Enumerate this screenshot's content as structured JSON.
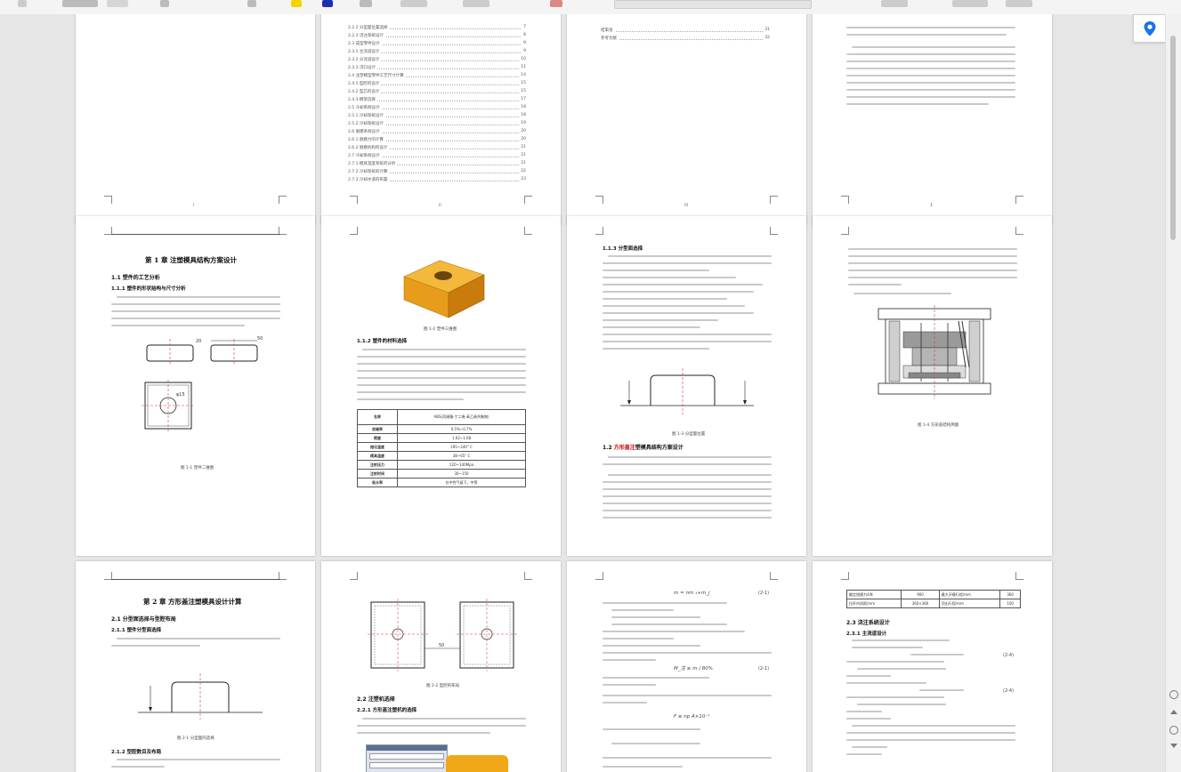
{
  "pages": {
    "p1": {
      "page_number": "i"
    },
    "p2": {
      "page_number": "ii",
      "toc": [
        {
          "label": "2.2.2 分型面位置选择",
          "page": "7"
        },
        {
          "label": "2.2.3 浇注系统设计",
          "page": "8"
        },
        {
          "label": "2.3 成型零件设计",
          "page": "9"
        },
        {
          "label": "2.3.1 主流道设计",
          "page": "9"
        },
        {
          "label": "2.3.2 分流道设计",
          "page": "10"
        },
        {
          "label": "2.3.3 浇口设计",
          "page": "11"
        },
        {
          "label": "2.4 注塑模型零件工艺尺寸计算",
          "page": "14"
        },
        {
          "label": "2.4.1 型腔的设计",
          "page": "15"
        },
        {
          "label": "2.4.2 型芯的设计",
          "page": "15"
        },
        {
          "label": "2.4.3 模架选择",
          "page": "17"
        },
        {
          "label": "2.5 冷却系统设计",
          "page": "18"
        },
        {
          "label": "2.5.1 冷却系统设计",
          "page": "18"
        },
        {
          "label": "2.5.2 冷却系统设计",
          "page": "19"
        },
        {
          "label": "2.6 脱模系统设计",
          "page": "20"
        },
        {
          "label": "2.6.1 脱模力的计算",
          "page": "20"
        },
        {
          "label": "2.6.2 脱模机构的设计",
          "page": "21"
        },
        {
          "label": "2.7 冷却系统设计",
          "page": "21"
        },
        {
          "label": "2.7.1 模具温度系统的分析",
          "page": "21"
        },
        {
          "label": "2.7.2 冷却系统的计算",
          "page": "22"
        },
        {
          "label": "2.7.3 冷却水道的布置",
          "page": "23"
        }
      ]
    },
    "p3": {
      "page_number": "iii",
      "toc": [
        {
          "label": "结束语",
          "page": "31"
        },
        {
          "label": "参考文献",
          "page": "32"
        }
      ]
    },
    "p4": {
      "page_number": "1"
    },
    "p5": {
      "chapter_title": "第 1 章 注塑模具结构方案设计",
      "sec1": "1.1 塑件的工艺分析",
      "sec11": "1.1.1 塑件的形状结构与尺寸分析",
      "fig_caption": "图 1-1 塑件二维图",
      "dim_top": "50",
      "dim_side": "20",
      "dim_hole": "φ15"
    },
    "p6": {
      "fig_caption": "图 1-2 塑件三维图",
      "sec112": "1.1.2 塑件的材料选择",
      "table_header": [
        "名称",
        "ABS(丙烯腈-丁二烯-苯乙烯共聚物)"
      ],
      "table_rows": [
        [
          "收缩率",
          "0.5%~0.7%"
        ],
        [
          "密度",
          "1.02~1.08"
        ],
        [
          "熔化温度",
          "195~240° C"
        ],
        [
          "模具温度",
          "38~65° C"
        ],
        [
          "注射压力",
          "120~140Mpa"
        ],
        [
          "注射时间",
          "30~150"
        ],
        [
          "吸水率",
          "在中性气候下，中等"
        ]
      ]
    },
    "p7": {
      "sec113": "1.1.3 分型面选择",
      "fig_caption": "图 1-3 分型面位置",
      "sec12_red": "方形盖注",
      "sec12_rest": "塑模具结构方案设计",
      "sec12_prefix": "1.2 "
    },
    "p8": {
      "fig_caption": "图 1-4 方形盖结构简图"
    },
    "p9": {
      "chapter_title": "第 2 章 方形盖注塑模具设计计算",
      "sec21": "2.1 分型面选择与型腔布局",
      "sec211": "2.1.1 塑件分型面选择",
      "fig_caption": "图 2-1 分型面的选择",
      "sec212": "2.1.2 型腔数目及布局"
    },
    "p10": {
      "fig_caption": "图 2-2 型腔的布局",
      "sec22": "2.2 注塑机选择",
      "sec221": "2.2.1 方形盖注塑机的选择",
      "dim_mid": "50"
    },
    "p11": {
      "formula1": "m = nm ₁+m_j",
      "eq1": "(2-1)",
      "formula2": "M_注 ≥ m / 80%",
      "eq2": "(2-1)",
      "formula3": "F ≥ np A×10⁻¹"
    },
    "p12": {
      "table_rows": [
        [
          "额定锁模力/kN",
          "900",
          "最大开模行程/mm",
          "360"
        ],
        [
          "拉杆内间距/mm",
          "360×360",
          "顶出行程/mm",
          "100"
        ]
      ],
      "sec23": "2.3 浇注系统设计",
      "sec231": "2.3.1 主流道设计",
      "eq1": "(2-4)",
      "eq2": "(2-4)"
    }
  },
  "colors": {
    "accent": "#1a73e8",
    "part": "#f0a818"
  }
}
